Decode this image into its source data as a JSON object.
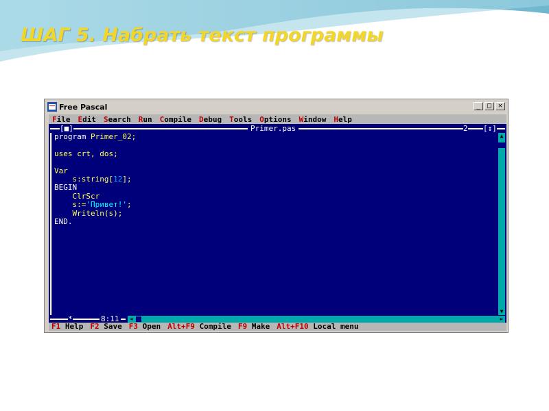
{
  "slide": {
    "title": "ШАГ 5. Набрать текст программы"
  },
  "window": {
    "title": "Free Pascal",
    "buttons": {
      "minimize": "_",
      "maximize": "□",
      "close": "✕"
    }
  },
  "menu": [
    {
      "hotkey": "F",
      "rest": "ile"
    },
    {
      "hotkey": "E",
      "rest": "dit"
    },
    {
      "hotkey": "S",
      "rest": "earch"
    },
    {
      "hotkey": "R",
      "rest": "un"
    },
    {
      "hotkey": "C",
      "rest": "ompile"
    },
    {
      "hotkey": "D",
      "rest": "ebug"
    },
    {
      "hotkey": "T",
      "rest": "ools"
    },
    {
      "hotkey": "O",
      "rest": "ptions"
    },
    {
      "hotkey": "W",
      "rest": "indow"
    },
    {
      "hotkey": "H",
      "rest": "elp"
    }
  ],
  "editor": {
    "filename": "Primer.pas",
    "window_number": "2",
    "close_box": "[■]",
    "zoom_box": "[↕]",
    "modified_marker": "*",
    "cursor_position": "8:11",
    "code": {
      "l1_kw": "program ",
      "l1_id": "Primer_02;",
      "l3": "uses crt, dos;",
      "l5": "Var",
      "l6_pre": "    s:string[",
      "l6_num": "12",
      "l6_post": "];",
      "l7": "BEGIN",
      "l8": "    ClrScr",
      "l9_pre": "    s:=",
      "l9_str": "'Привет!'",
      "l9_post": ";",
      "l10": "    Writeln(s);",
      "l11": "END."
    }
  },
  "status": [
    {
      "key": "F1",
      "label": " Help"
    },
    {
      "key": "F2",
      "label": " Save"
    },
    {
      "key": "F3",
      "label": " Open"
    },
    {
      "key": "Alt+F9",
      "label": " Compile"
    },
    {
      "key": "F9",
      "label": " Make"
    },
    {
      "key": "Alt+F10",
      "label": " Local menu"
    }
  ],
  "colors": {
    "editor_bg": "#00007a",
    "menu_bg": "#b7b7b7",
    "hotkey": "#c00000",
    "title_yellow": "#f2d62a"
  }
}
